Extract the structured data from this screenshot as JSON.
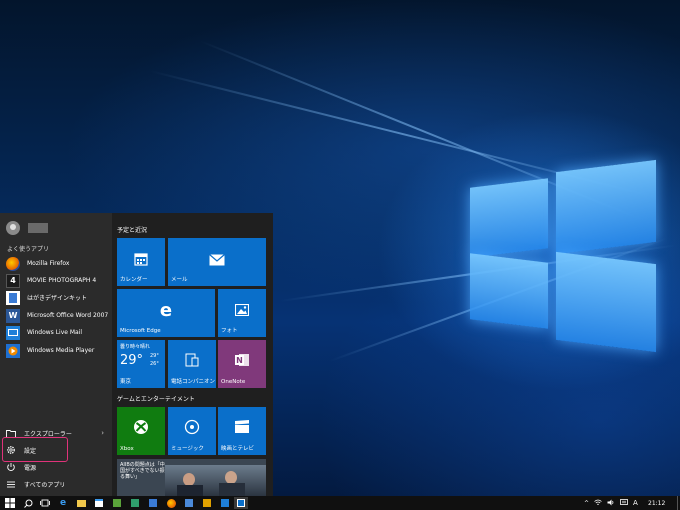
{
  "start_menu": {
    "most_used_label": "よく使うアプリ",
    "apps": [
      {
        "label": "Mozilla Firefox",
        "icon": "firefox-icon",
        "color": "#e66000"
      },
      {
        "label": "MOVIE PHOTOGRAPH 4",
        "icon": "movie-photograph-icon",
        "glyph": "4",
        "color": "#1b1b1b"
      },
      {
        "label": "はがきデザインキット",
        "icon": "hagaki-icon",
        "color": "#3a7bd5"
      },
      {
        "label": "Microsoft Office Word 2007",
        "icon": "word-icon",
        "glyph": "W",
        "color": "#2b5797"
      },
      {
        "label": "Windows Live Mail",
        "icon": "live-mail-icon",
        "color": "#1e7fd8"
      },
      {
        "label": "Windows Media Player",
        "icon": "media-player-icon",
        "color": "#f08a00"
      }
    ],
    "explorer_label": "エクスプローラー",
    "settings_label": "設定",
    "power_label": "電源",
    "all_apps_label": "すべてのアプリ"
  },
  "tiles": {
    "group1_label": "予定と近況",
    "group2_label": "ゲームとエンターテイメント",
    "calendar": "カレンダー",
    "mail": "メール",
    "edge": "Microsoft Edge",
    "photos": "フォト",
    "weather": {
      "condition": "曇り時々晴れ",
      "temp": "29°",
      "high": "29°",
      "low": "26°",
      "city": "東京"
    },
    "phone_companion": "電話コンパニオン",
    "onenote": "OneNote",
    "xbox": "Xbox",
    "music": "ミュージック",
    "movies": "映画とテレビ",
    "news_headline": "AIIBの問題点は「中国がすべきでない振る舞い」"
  },
  "taskbar": {
    "ime": "A",
    "time": "21:12"
  },
  "colors": {
    "tile_blue": "#0a6fca",
    "xbox_green": "#107c10",
    "onenote_purple": "#80397b",
    "highlight_pink": "#e0337a"
  }
}
